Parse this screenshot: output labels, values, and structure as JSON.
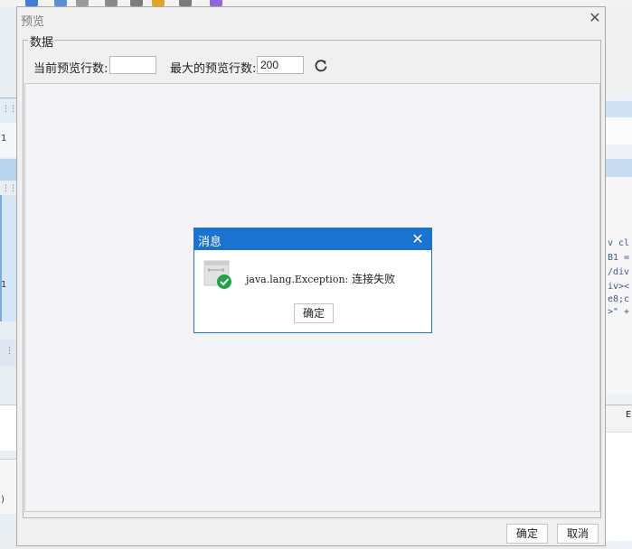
{
  "dialog": {
    "title": "预览",
    "group_label": "数据",
    "current_rows_label": "当前预览行数:",
    "current_rows_value": "",
    "max_rows_label": "最大的预览行数:",
    "max_rows_value": "200",
    "refresh_icon": "refresh-icon",
    "ok_label": "确定",
    "cancel_label": "取消"
  },
  "message": {
    "title": "消息",
    "exception": "java.lang.Exception:",
    "text": "连接失败",
    "ok_label": "确定",
    "icon": "success-check-icon"
  },
  "background": {
    "left_numbers": [
      "1",
      "1",
      ")"
    ],
    "right_code": [
      "v cl",
      "B1 =",
      "/div",
      "iv><",
      "e8;c",
      ">\" +"
    ],
    "right_tab_text": "E"
  },
  "colors": {
    "titlebar_blue": "#1a73cf",
    "check_green": "#1fa34a"
  }
}
